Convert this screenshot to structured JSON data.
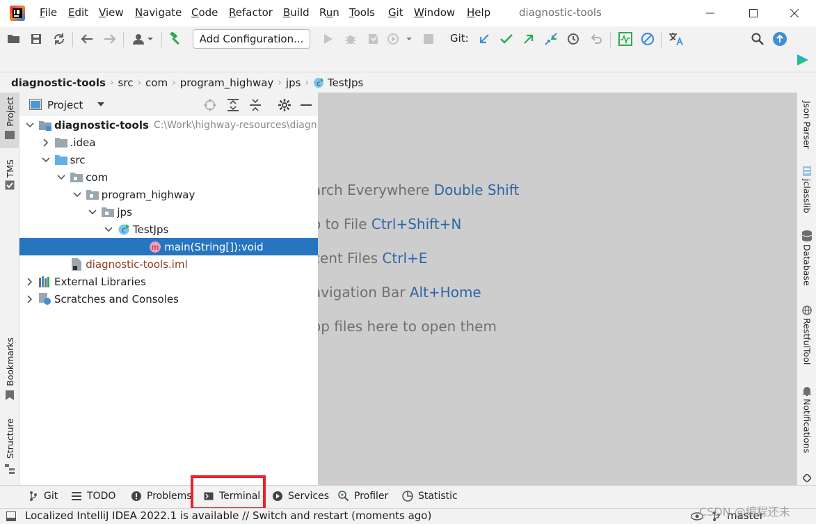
{
  "menu": {
    "items": [
      "File",
      "Edit",
      "View",
      "Navigate",
      "Code",
      "Refactor",
      "Build",
      "Run",
      "Tools",
      "Git",
      "Window",
      "Help"
    ],
    "mnemonics": [
      "F",
      "E",
      "V",
      "N",
      "C",
      "R",
      "B",
      "u",
      "T",
      "G",
      "W",
      "H"
    ]
  },
  "window": {
    "title": "diagnostic-tools"
  },
  "toolbar": {
    "add_configuration": "Add Configuration...",
    "git_label": "Git:"
  },
  "breadcrumb": [
    "diagnostic-tools",
    "src",
    "com",
    "program_highway",
    "jps",
    "TestJps"
  ],
  "project_panel": {
    "title": "Project",
    "root_path": "C:\\Work\\highway-resources\\diagn",
    "tree": [
      {
        "label": "diagnostic-tools",
        "depth": 0,
        "expanded": true,
        "icon": "module-folder-icon",
        "bold": true
      },
      {
        "label": ".idea",
        "depth": 1,
        "expanded": false,
        "icon": "folder-icon"
      },
      {
        "label": "src",
        "depth": 1,
        "expanded": true,
        "icon": "source-folder-icon"
      },
      {
        "label": "com",
        "depth": 2,
        "expanded": true,
        "icon": "package-icon"
      },
      {
        "label": "program_highway",
        "depth": 3,
        "expanded": true,
        "icon": "package-icon"
      },
      {
        "label": "jps",
        "depth": 4,
        "expanded": true,
        "icon": "package-icon"
      },
      {
        "label": "TestJps",
        "depth": 5,
        "expanded": true,
        "icon": "class-icon"
      },
      {
        "label": "main(String[]):void",
        "depth": 7,
        "selected": true,
        "icon": "method-icon"
      },
      {
        "label": "diagnostic-tools.iml",
        "depth": 2,
        "icon": "iml-file-icon",
        "color": "#8c3b21"
      },
      {
        "label": "External Libraries",
        "depth": 0,
        "expanded": false,
        "icon": "libraries-icon"
      },
      {
        "label": "Scratches and Consoles",
        "depth": 0,
        "expanded": false,
        "icon": "scratches-icon"
      }
    ]
  },
  "editor_hints": [
    {
      "text": "arch Everywhere ",
      "key": "Double Shift"
    },
    {
      "text": "o to File ",
      "key": "Ctrl+Shift+N"
    },
    {
      "text": "cent Files ",
      "key": "Ctrl+E"
    },
    {
      "text": "avigation Bar ",
      "key": "Alt+Home"
    },
    {
      "text": "op files here to open them",
      "key": ""
    }
  ],
  "left_strip": {
    "project": "Project",
    "tms": "TMS",
    "bookmarks": "Bookmarks",
    "structure": "Structure"
  },
  "right_strip": {
    "json_parser": "Json Parser",
    "jclasslib": "jclasslib",
    "database": "Database",
    "restful_tool": "RestfulTool",
    "notifications": "Notifications"
  },
  "bottom_tabs": [
    "Git",
    "TODO",
    "Problems",
    "Terminal",
    "Services",
    "Profiler",
    "Statistic"
  ],
  "status": {
    "message": "Localized IntelliJ IDEA 2022.1 is available // Switch and restart (moments ago)",
    "branch": "master"
  },
  "watermark": "CSDN @编程还未",
  "colors": {
    "selection": "#2675bf",
    "accent_blue": "#2f65a8",
    "highlight_red": "#e8232a",
    "git_green": "#2fa84f"
  }
}
